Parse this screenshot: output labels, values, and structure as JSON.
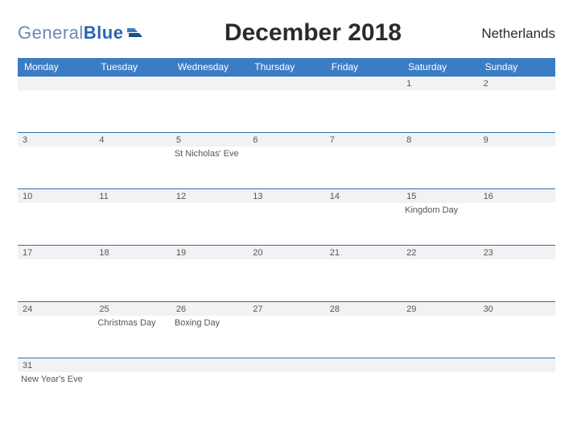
{
  "brand": {
    "part1": "General",
    "part2": "Blue"
  },
  "title": "December 2018",
  "country": "Netherlands",
  "day_labels": [
    "Monday",
    "Tuesday",
    "Wednesday",
    "Thursday",
    "Friday",
    "Saturday",
    "Sunday"
  ],
  "weeks": [
    {
      "days": [
        "",
        "",
        "",
        "",
        "",
        "1",
        "2"
      ],
      "events": [
        "",
        "",
        "",
        "",
        "",
        "",
        ""
      ]
    },
    {
      "days": [
        "3",
        "4",
        "5",
        "6",
        "7",
        "8",
        "9"
      ],
      "events": [
        "",
        "",
        "St Nicholas' Eve",
        "",
        "",
        "",
        ""
      ]
    },
    {
      "days": [
        "10",
        "11",
        "12",
        "13",
        "14",
        "15",
        "16"
      ],
      "events": [
        "",
        "",
        "",
        "",
        "",
        "Kingdom Day",
        ""
      ]
    },
    {
      "days": [
        "17",
        "18",
        "19",
        "20",
        "21",
        "22",
        "23"
      ],
      "events": [
        "",
        "",
        "",
        "",
        "",
        "",
        ""
      ]
    },
    {
      "days": [
        "24",
        "25",
        "26",
        "27",
        "28",
        "29",
        "30"
      ],
      "events": [
        "",
        "Christmas Day",
        "Boxing Day",
        "",
        "",
        "",
        ""
      ]
    },
    {
      "days": [
        "31",
        "",
        "",
        "",
        "",
        "",
        ""
      ],
      "events": [
        "New Year's Eve",
        "",
        "",
        "",
        "",
        "",
        ""
      ]
    }
  ]
}
